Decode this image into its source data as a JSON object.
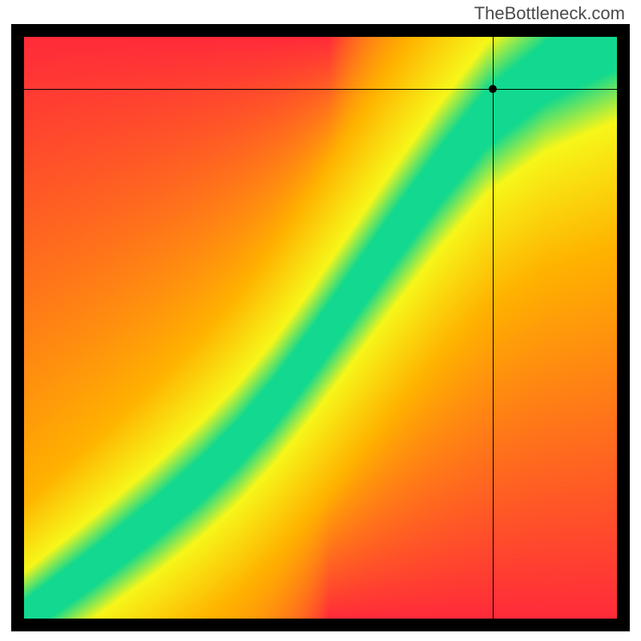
{
  "watermark": "TheBottleneck.com",
  "chart_data": {
    "type": "heatmap",
    "title": "",
    "xlabel": "",
    "ylabel": "",
    "xlim": [
      0,
      100
    ],
    "ylim": [
      0,
      100
    ],
    "crosshair": {
      "x": 79,
      "y": 91
    },
    "optimal_ridge": [
      {
        "x": 0,
        "y": 0
      },
      {
        "x": 12,
        "y": 9
      },
      {
        "x": 22,
        "y": 17
      },
      {
        "x": 30,
        "y": 24
      },
      {
        "x": 36,
        "y": 30
      },
      {
        "x": 42,
        "y": 37
      },
      {
        "x": 48,
        "y": 45
      },
      {
        "x": 55,
        "y": 55
      },
      {
        "x": 62,
        "y": 65
      },
      {
        "x": 70,
        "y": 76
      },
      {
        "x": 78,
        "y": 86
      },
      {
        "x": 88,
        "y": 94
      },
      {
        "x": 100,
        "y": 100
      }
    ],
    "ridge_half_width": 5,
    "colors": {
      "optimal": "#12d98f",
      "near": "#f7f71a",
      "mid": "#ffb300",
      "far": "#ff2b3a"
    }
  }
}
